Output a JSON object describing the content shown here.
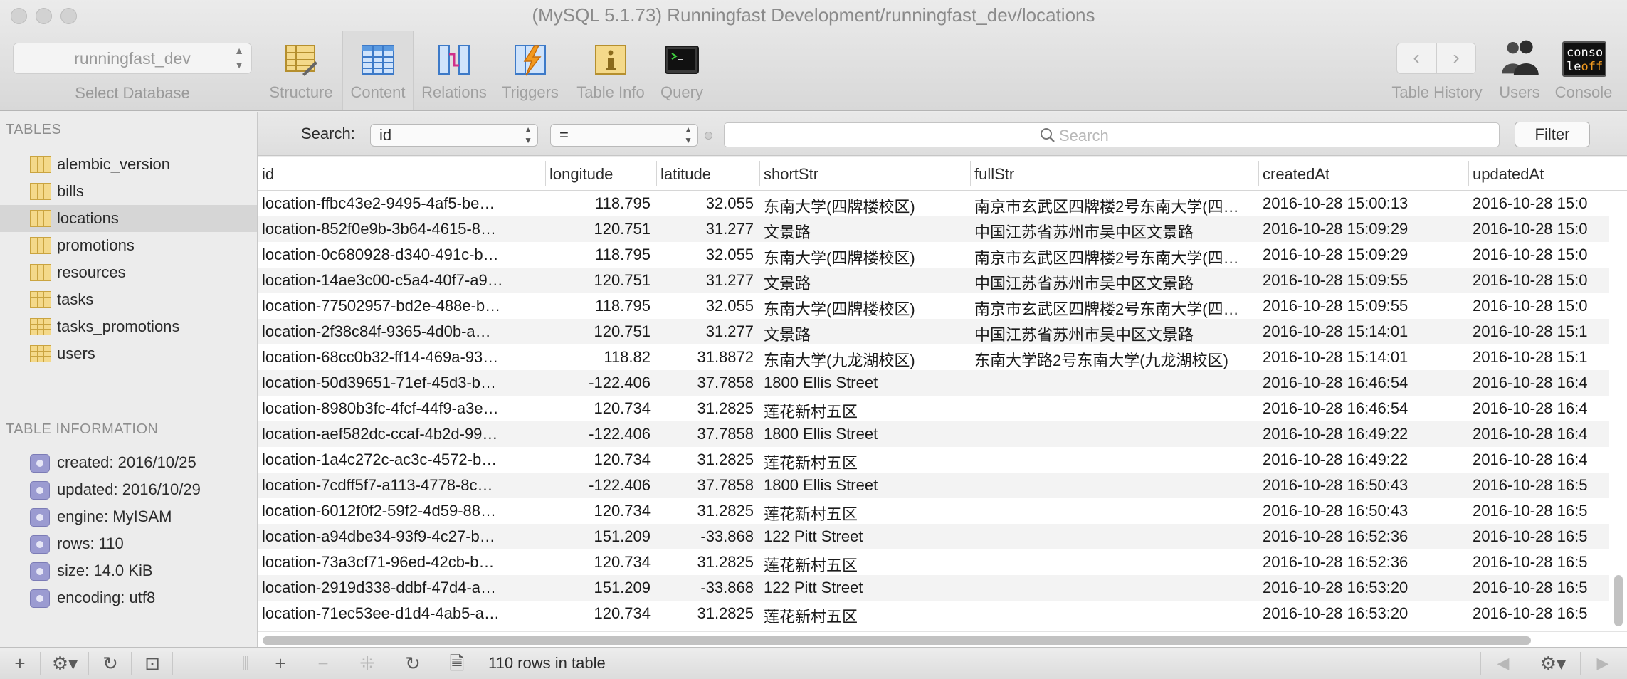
{
  "window": {
    "title": "(MySQL 5.1.73) Runningfast Development/runningfast_dev/locations"
  },
  "database": {
    "value": "runningfast_dev",
    "caption": "Select Database"
  },
  "toolbar": {
    "structure": "Structure",
    "content": "Content",
    "relations": "Relations",
    "triggers": "Triggers",
    "table_info": "Table Info",
    "query": "Query",
    "table_history": "Table History",
    "users": "Users",
    "console": "Console",
    "console_icon_text_1": "conso",
    "console_icon_text_2a": "le",
    "console_icon_text_2b": "off"
  },
  "sidebar": {
    "tables_header": "TABLES",
    "tables": [
      {
        "name": "alembic_version"
      },
      {
        "name": "bills"
      },
      {
        "name": "locations"
      },
      {
        "name": "promotions"
      },
      {
        "name": "resources"
      },
      {
        "name": "tasks"
      },
      {
        "name": "tasks_promotions"
      },
      {
        "name": "users"
      }
    ],
    "selected_table": "locations",
    "info_header": "TABLE INFORMATION",
    "info": [
      "created: 2016/10/25",
      "updated: 2016/10/29",
      "engine: MyISAM",
      "rows: 110",
      "size: 14.0 KiB",
      "encoding: utf8"
    ]
  },
  "filter": {
    "label": "Search:",
    "field": "id",
    "operator": "=",
    "placeholder": "Search",
    "button": "Filter"
  },
  "table": {
    "columns": [
      "id",
      "longitude",
      "latitude",
      "shortStr",
      "fullStr",
      "createdAt",
      "updatedAt"
    ],
    "rows": [
      [
        "location-ffbc43e2-9495-4af5-be…",
        "118.795",
        "32.055",
        "东南大学(四牌楼校区)",
        "南京市玄武区四牌楼2号东南大学(四…",
        "2016-10-28 15:00:13",
        "2016-10-28 15:0"
      ],
      [
        "location-852f0e9b-3b64-4615-8…",
        "120.751",
        "31.277",
        "文景路",
        "中国江苏省苏州市吴中区文景路",
        "2016-10-28 15:09:29",
        "2016-10-28 15:0"
      ],
      [
        "location-0c680928-d340-491c-b…",
        "118.795",
        "32.055",
        "东南大学(四牌楼校区)",
        "南京市玄武区四牌楼2号东南大学(四…",
        "2016-10-28 15:09:29",
        "2016-10-28 15:0"
      ],
      [
        "location-14ae3c00-c5a4-40f7-a9…",
        "120.751",
        "31.277",
        "文景路",
        "中国江苏省苏州市吴中区文景路",
        "2016-10-28 15:09:55",
        "2016-10-28 15:0"
      ],
      [
        "location-77502957-bd2e-488e-b…",
        "118.795",
        "32.055",
        "东南大学(四牌楼校区)",
        "南京市玄武区四牌楼2号东南大学(四…",
        "2016-10-28 15:09:55",
        "2016-10-28 15:0"
      ],
      [
        "location-2f38c84f-9365-4d0b-a…",
        "120.751",
        "31.277",
        "文景路",
        "中国江苏省苏州市吴中区文景路",
        "2016-10-28 15:14:01",
        "2016-10-28 15:1"
      ],
      [
        "location-68cc0b32-ff14-469a-93…",
        "118.82",
        "31.8872",
        "东南大学(九龙湖校区)",
        "东南大学路2号东南大学(九龙湖校区)",
        "2016-10-28 15:14:01",
        "2016-10-28 15:1"
      ],
      [
        "location-50d39651-71ef-45d3-b…",
        "-122.406",
        "37.7858",
        "1800 Ellis Street",
        "",
        "2016-10-28 16:46:54",
        "2016-10-28 16:4"
      ],
      [
        "location-8980b3fc-4fcf-44f9-a3e…",
        "120.734",
        "31.2825",
        "莲花新村五区",
        "",
        "2016-10-28 16:46:54",
        "2016-10-28 16:4"
      ],
      [
        "location-aef582dc-ccaf-4b2d-99…",
        "-122.406",
        "37.7858",
        "1800 Ellis Street",
        "",
        "2016-10-28 16:49:22",
        "2016-10-28 16:4"
      ],
      [
        "location-1a4c272c-ac3c-4572-b…",
        "120.734",
        "31.2825",
        "莲花新村五区",
        "",
        "2016-10-28 16:49:22",
        "2016-10-28 16:4"
      ],
      [
        "location-7cdff5f7-a113-4778-8c…",
        "-122.406",
        "37.7858",
        "1800 Ellis Street",
        "",
        "2016-10-28 16:50:43",
        "2016-10-28 16:5"
      ],
      [
        "location-6012f0f2-59f2-4d59-88…",
        "120.734",
        "31.2825",
        "莲花新村五区",
        "",
        "2016-10-28 16:50:43",
        "2016-10-28 16:5"
      ],
      [
        "location-a94dbe34-93f9-4c27-b…",
        "151.209",
        "-33.868",
        "122 Pitt Street",
        "",
        "2016-10-28 16:52:36",
        "2016-10-28 16:5"
      ],
      [
        "location-73a3cf71-96ed-42cb-b…",
        "120.734",
        "31.2825",
        "莲花新村五区",
        "",
        "2016-10-28 16:52:36",
        "2016-10-28 16:5"
      ],
      [
        "location-2919d338-ddbf-47d4-a…",
        "151.209",
        "-33.868",
        "122 Pitt Street",
        "",
        "2016-10-28 16:53:20",
        "2016-10-28 16:5"
      ],
      [
        "location-71ec53ee-d1d4-4ab5-a…",
        "120.734",
        "31.2825",
        "莲花新村五区",
        "",
        "2016-10-28 16:53:20",
        "2016-10-28 16:5"
      ]
    ]
  },
  "status": {
    "row_count": "110 rows in table",
    "add": "+",
    "remove": "−",
    "duplicate": "⁜",
    "refresh": "↻",
    "prev": "◀",
    "next": "▶"
  },
  "colors": {
    "selected_row": "#d6d6d6",
    "stripe": "#f3f3f3",
    "table_icon": "#f4d98a",
    "info_icon": "#9b9bd1"
  }
}
